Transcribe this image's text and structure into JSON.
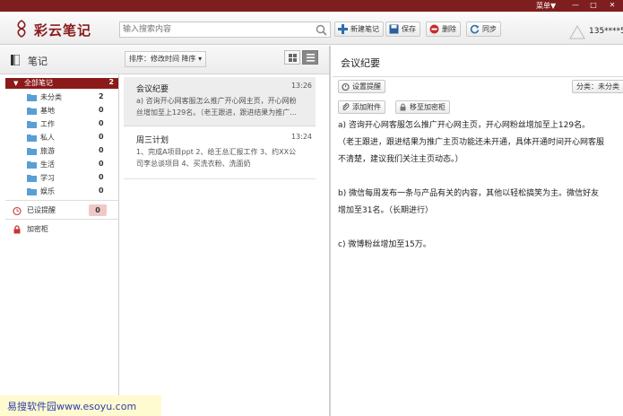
{
  "titlebar": {
    "menu_label": "菜单▼",
    "min_glyph": "—",
    "max_glyph": "□",
    "close_glyph": "✕"
  },
  "app": {
    "logo_text": "彩云笔记"
  },
  "search": {
    "placeholder": "输入搜索内容"
  },
  "toolbar": {
    "new_label": "新建笔记",
    "save_label": "保存",
    "delete_label": "删除",
    "sync_label": "同步",
    "user_label": "135****5"
  },
  "sidebar": {
    "title": "笔记",
    "all_notes": {
      "label": "全部笔记",
      "count": "2"
    },
    "folders": [
      {
        "label": "未分类",
        "count": "2"
      },
      {
        "label": "基地",
        "count": "0"
      },
      {
        "label": "工作",
        "count": "0"
      },
      {
        "label": "私人",
        "count": "0"
      },
      {
        "label": "旅游",
        "count": "0"
      },
      {
        "label": "生活",
        "count": "0"
      },
      {
        "label": "学习",
        "count": "0"
      },
      {
        "label": "娱乐",
        "count": "0"
      }
    ],
    "reminders": {
      "label": "已设提醒",
      "count": "0"
    },
    "vault": {
      "label": "加密柜"
    }
  },
  "list": {
    "sort_label": "排序：修改时间 降序 ▾",
    "notes": [
      {
        "title": "会议纪要",
        "time": "13:26",
        "snippet_line1": "a) 咨询开心网客服怎么推广开心网主页，开心网粉",
        "snippet_line2": "丝增加至上129名。（老王跟进，跟进结果为推广..."
      },
      {
        "title": "周三计划",
        "time": "13:24",
        "snippet_line1": "1、完成A项目ppt 2、给王总汇报工作 3、约XX公",
        "snippet_line2": "司李总谈项目 4、买洗衣粉、洗面奶"
      }
    ]
  },
  "editor": {
    "title": "会议纪要",
    "set_reminder_label": "设置提醒",
    "category_label": "分类：未分类",
    "attach_label": "添加附件",
    "move_vault_label": "移至加密柜",
    "body": [
      "a)   咨询开心网客服怎么推广开心网主页，开心网粉丝增加至上129名。",
      "（老王跟进，跟进结果为推广主页功能还未开通，具体开通时间开心网客服",
      "不清楚，建议我们关注主页动态。）",
      "",
      "b)   微信每周发布一条与产品有关的内容，其他以轻松搞笑为主。微信好友",
      "增加至31名。（长期进行）",
      "",
      "c)   微博粉丝增加至15万。"
    ]
  },
  "watermark": {
    "text": "易搜软件园www.esoyu.com"
  },
  "colors": {
    "brand": "#8b1a1a",
    "titlebar": "#7e1e1e",
    "watermark_text": "#2f3ea8"
  }
}
